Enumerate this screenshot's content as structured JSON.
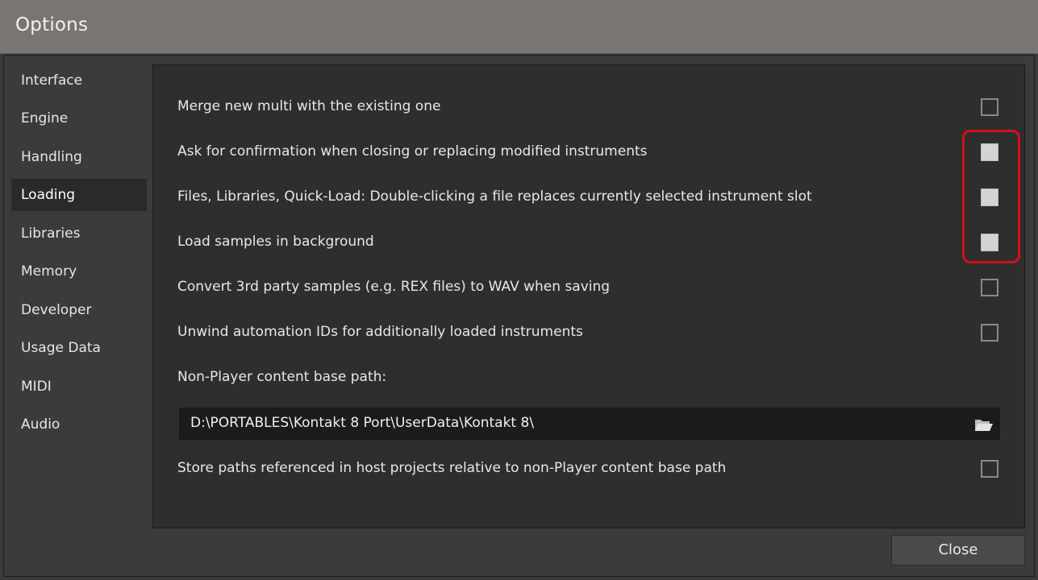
{
  "window": {
    "title": "Options"
  },
  "sidebar": {
    "items": [
      {
        "label": "Interface"
      },
      {
        "label": "Engine"
      },
      {
        "label": "Handling"
      },
      {
        "label": "Loading",
        "active": true
      },
      {
        "label": "Libraries"
      },
      {
        "label": "Memory"
      },
      {
        "label": "Developer"
      },
      {
        "label": "Usage Data"
      },
      {
        "label": "MIDI"
      },
      {
        "label": "Audio"
      }
    ]
  },
  "loading": {
    "options": [
      {
        "label": "Merge new multi with the existing one",
        "checked": false
      },
      {
        "label": "Ask for confirmation when closing or replacing modified instruments",
        "checked": true
      },
      {
        "label": "Files, Libraries, Quick-Load: Double-clicking a file replaces currently selected instrument slot",
        "checked": true
      },
      {
        "label": "Load samples in background",
        "checked": true
      },
      {
        "label": "Convert 3rd party samples (e.g. REX files) to WAV when saving",
        "checked": false
      },
      {
        "label": "Unwind automation IDs for additionally loaded instruments",
        "checked": false
      }
    ],
    "base_path_label": "Non-Player content base path:",
    "base_path_value": "D:\\PORTABLES\\Kontakt 8 Port\\UserData\\Kontakt 8\\",
    "store_paths_label": "Store paths referenced in host projects relative to non-Player content base path",
    "store_paths_checked": false
  },
  "footer": {
    "close_label": "Close"
  },
  "icons": {
    "browse": "folder-open-icon"
  },
  "colors": {
    "highlight": "#d4101a",
    "active_nav": "#2a2a2a",
    "panel": "#2e2e2e"
  }
}
